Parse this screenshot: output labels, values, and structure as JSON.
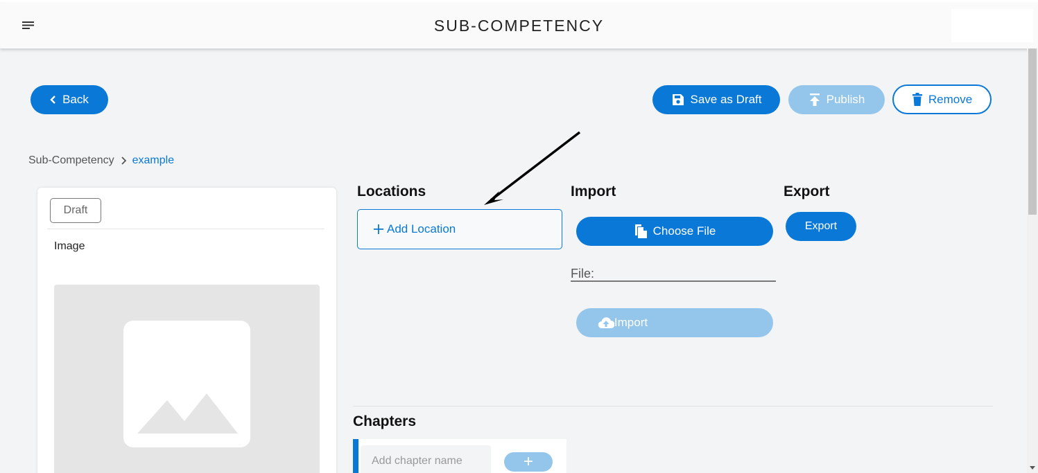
{
  "appbar": {
    "title": "SUB-COMPETENCY"
  },
  "actions": {
    "back_label": "Back",
    "save_draft_label": "Save as Draft",
    "publish_label": "Publish",
    "remove_label": "Remove"
  },
  "breadcrumb": {
    "root": "Sub-Competency",
    "current": "example"
  },
  "card": {
    "status": "Draft",
    "image_label": "Image"
  },
  "locations": {
    "title": "Locations",
    "add_label": "Add Location"
  },
  "import": {
    "title": "Import",
    "choose_label": "Choose File",
    "file_label": "File:",
    "import_label": "Import"
  },
  "export": {
    "title": "Export",
    "export_label": "Export"
  },
  "chapters": {
    "title": "Chapters",
    "placeholder": "Add chapter name",
    "add_label": "+"
  },
  "colors": {
    "accent": "#0a78d7",
    "accent_disabled": "#94c6ec",
    "background": "#f2f4f6"
  },
  "icons": [
    "menu-icon",
    "chevron-left-icon",
    "save-icon",
    "upload-icon",
    "trash-icon",
    "chevron-right-icon",
    "plus-icon",
    "file-copy-icon",
    "cloud-upload-icon",
    "image-placeholder-icon",
    "arrow-annotation"
  ]
}
